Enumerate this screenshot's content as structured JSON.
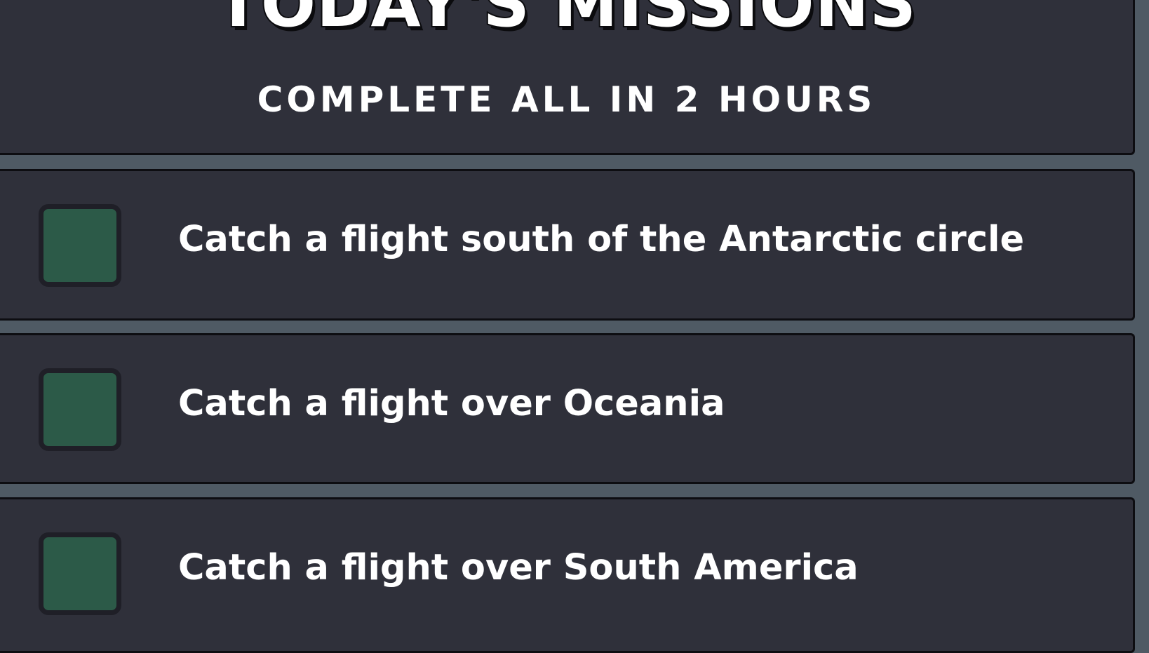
{
  "header": {
    "title": "TODAY'S MISSIONS",
    "subtitle": "COMPLETE ALL IN 2 HOURS"
  },
  "missions": [
    {
      "label": "Catch a flight south of the Antarctic circle",
      "completed": false
    },
    {
      "label": "Catch a flight over Oceania",
      "completed": false
    },
    {
      "label": "Catch a flight over South America",
      "completed": false
    }
  ],
  "colors": {
    "panel": "#2f303a",
    "checkbox_fill": "#2c5a48",
    "separator": "#4f5a64",
    "text": "#ffffff"
  }
}
